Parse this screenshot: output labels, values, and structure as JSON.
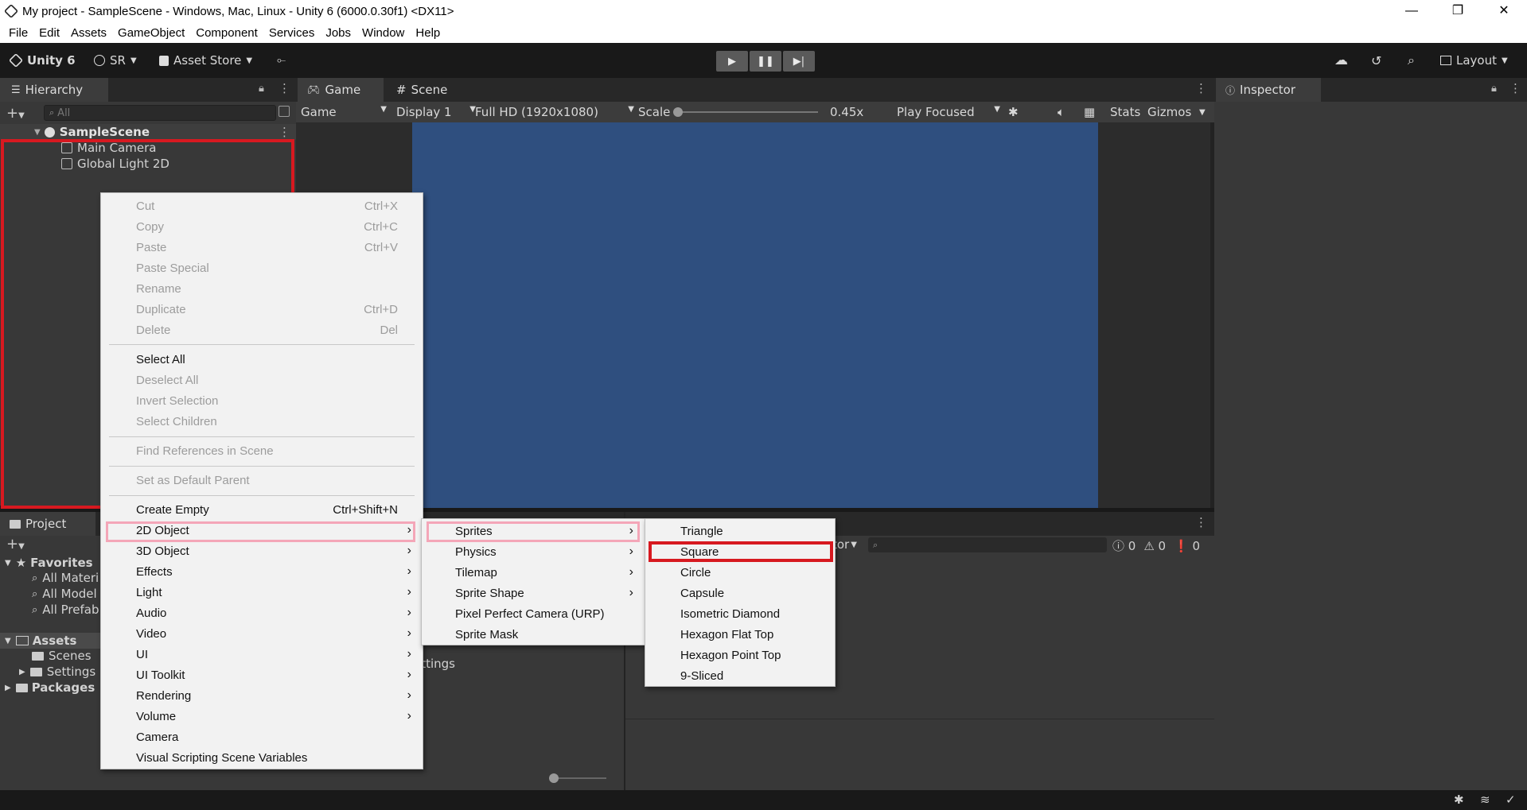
{
  "titlebar": {
    "title": "My project - SampleScene - Windows, Mac, Linux - Unity 6 (6000.0.30f1) <DX11>",
    "minimize": "—",
    "restore": "❐",
    "close": "✕"
  },
  "menubar": [
    "File",
    "Edit",
    "Assets",
    "GameObject",
    "Component",
    "Services",
    "Jobs",
    "Window",
    "Help"
  ],
  "toolbar": {
    "unity_label": "Unity 6",
    "account": "SR",
    "asset_store": "Asset Store",
    "layout": "Layout"
  },
  "hierarchy": {
    "tab": "Hierarchy",
    "search_placeholder": "All",
    "scene": "SampleScene",
    "items": [
      "Main Camera",
      "Global Light 2D"
    ]
  },
  "game_view": {
    "tab_game": "Game",
    "tab_scene": "Scene",
    "display_mode": "Game",
    "display": "Display 1",
    "resolution": "Full HD (1920x1080)",
    "scale_label": "Scale",
    "scale_value": "0.45x",
    "play_mode": "Play Focused",
    "stats": "Stats",
    "gizmos": "Gizmos",
    "bg_color": "#2f4f7f"
  },
  "inspector": {
    "tab": "Inspector"
  },
  "project": {
    "tab": "Project",
    "favorites": "Favorites",
    "fav_items": [
      "All Materi",
      "All Model",
      "All Prefab"
    ],
    "assets": "Assets",
    "asset_items": [
      "Scenes",
      "Settings"
    ],
    "packages": "Packages",
    "partial_settings": "ettings"
  },
  "console": {
    "partial_label": "tor",
    "count_info": "0",
    "count_warn": "0",
    "count_err": "0"
  },
  "context_menu": {
    "items": [
      {
        "label": "Cut",
        "shortcut": "Ctrl+X",
        "disabled": true
      },
      {
        "label": "Copy",
        "shortcut": "Ctrl+C",
        "disabled": true
      },
      {
        "label": "Paste",
        "shortcut": "Ctrl+V",
        "disabled": true
      },
      {
        "label": "Paste Special",
        "shortcut": "",
        "disabled": true
      },
      {
        "label": "Rename",
        "shortcut": "",
        "disabled": true
      },
      {
        "label": "Duplicate",
        "shortcut": "Ctrl+D",
        "disabled": true
      },
      {
        "label": "Delete",
        "shortcut": "Del",
        "disabled": true
      },
      {
        "label": "Select All",
        "shortcut": "",
        "disabled": false
      },
      {
        "label": "Deselect All",
        "shortcut": "",
        "disabled": true
      },
      {
        "label": "Invert Selection",
        "shortcut": "",
        "disabled": true
      },
      {
        "label": "Select Children",
        "shortcut": "",
        "disabled": true
      },
      {
        "label": "Find References in Scene",
        "shortcut": "",
        "disabled": true
      },
      {
        "label": "Set as Default Parent",
        "shortcut": "",
        "disabled": true
      },
      {
        "label": "Create Empty",
        "shortcut": "Ctrl+Shift+N",
        "disabled": false
      },
      {
        "label": "2D Object",
        "shortcut": "",
        "disabled": false
      },
      {
        "label": "3D Object",
        "shortcut": "",
        "disabled": false
      },
      {
        "label": "Effects",
        "shortcut": "",
        "disabled": false
      },
      {
        "label": "Light",
        "shortcut": "",
        "disabled": false
      },
      {
        "label": "Audio",
        "shortcut": "",
        "disabled": false
      },
      {
        "label": "Video",
        "shortcut": "",
        "disabled": false
      },
      {
        "label": "UI",
        "shortcut": "",
        "disabled": false
      },
      {
        "label": "UI Toolkit",
        "shortcut": "",
        "disabled": false
      },
      {
        "label": "Rendering",
        "shortcut": "",
        "disabled": false
      },
      {
        "label": "Volume",
        "shortcut": "",
        "disabled": false
      },
      {
        "label": "Camera",
        "shortcut": "",
        "disabled": false
      },
      {
        "label": "Visual Scripting Scene Variables",
        "shortcut": "",
        "disabled": false
      }
    ]
  },
  "submenu_2d": {
    "items": [
      "Sprites",
      "Physics",
      "Tilemap",
      "Sprite Shape",
      "Pixel Perfect Camera (URP)",
      "Sprite Mask"
    ]
  },
  "submenu_sprites": {
    "items": [
      "Triangle",
      "Square",
      "Circle",
      "Capsule",
      "Isometric Diamond",
      "Hexagon Flat Top",
      "Hexagon Point Top",
      "9-Sliced"
    ]
  },
  "colors": {
    "highlight_pink": "#f4a6b8",
    "highlight_red": "#d71920"
  }
}
